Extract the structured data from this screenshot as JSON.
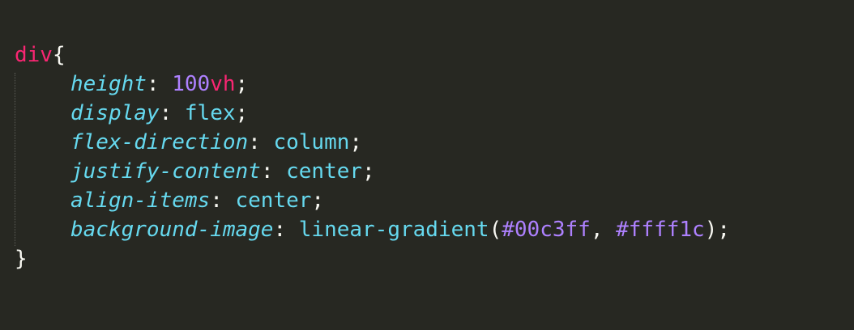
{
  "code": {
    "selector": "div",
    "open_brace": "{",
    "close_brace": "}",
    "declarations": [
      {
        "property": "height",
        "colon": ":",
        "value_number": "100",
        "value_unit": "vh",
        "semicolon": ";"
      },
      {
        "property": "display",
        "colon": ":",
        "value": "flex",
        "semicolon": ";"
      },
      {
        "property": "flex-direction",
        "colon": ":",
        "value": "column",
        "semicolon": ";"
      },
      {
        "property": "justify-content",
        "colon": ":",
        "value": "center",
        "semicolon": ";"
      },
      {
        "property": "align-items",
        "colon": ":",
        "value": "center",
        "semicolon": ";"
      },
      {
        "property": "background-image",
        "colon": ":",
        "function": "linear-gradient",
        "paren_open": "(",
        "arg1": "#00c3ff",
        "comma": ",",
        "arg2": "#ffff1c",
        "paren_close": ")",
        "semicolon": ";"
      }
    ]
  },
  "colors": {
    "background": "#272822",
    "selector": "#f92672",
    "property": "#66d9ef",
    "value": "#66d9ef",
    "number": "#ae81ff",
    "punctuation": "#f8f8f2"
  }
}
